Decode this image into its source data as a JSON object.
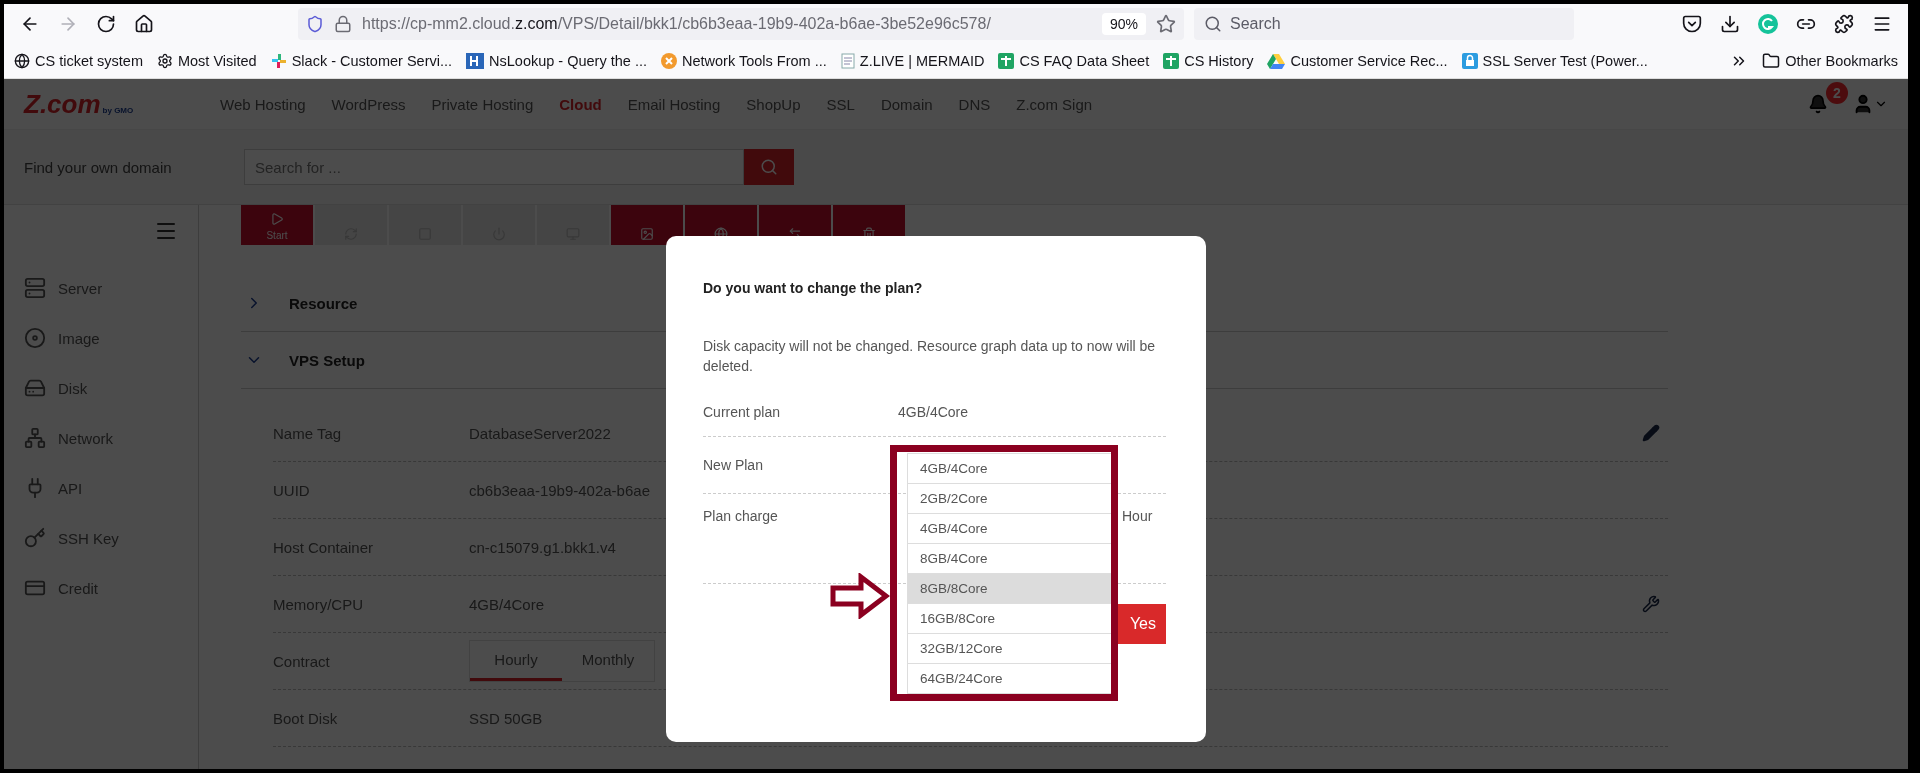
{
  "browser": {
    "back_disabled": false,
    "forward_disabled": true,
    "url": {
      "before": "https://cp-mm2.cloud.",
      "domain": "z.com",
      "after": "/VPS/Detail/bkk1/cb6b3eaa-19b9-402a-b6ae-3be52e96c578/"
    },
    "zoom": "90%",
    "search_placeholder": "Search",
    "bookmarks": [
      "CS ticket system",
      "Most Visited",
      "Slack - Customer Servi...",
      "NsLookup - Query the ...",
      "Network Tools From ...",
      "Z.LIVE | MERMAID",
      "CS FAQ Data Sheet",
      "CS History",
      "Customer Service Rec...",
      "SSL Server Test (Power..."
    ],
    "other_bookmarks": "Other Bookmarks"
  },
  "header": {
    "logo": "Z.com",
    "logo_sub": "by GMO",
    "nav": [
      {
        "label": "Web Hosting",
        "selected": false
      },
      {
        "label": "WordPress",
        "selected": false
      },
      {
        "label": "Private Hosting",
        "selected": false
      },
      {
        "label": "Cloud",
        "selected": true
      },
      {
        "label": "Email Hosting",
        "selected": false
      },
      {
        "label": "ShopUp",
        "selected": false
      },
      {
        "label": "SSL",
        "selected": false
      },
      {
        "label": "Domain",
        "selected": false
      },
      {
        "label": "DNS",
        "selected": false
      },
      {
        "label": "Z.com Sign",
        "selected": false
      }
    ],
    "notifications": "2"
  },
  "domain_search": {
    "label": "Find your own domain",
    "placeholder": "Search for ..."
  },
  "sidebar": {
    "items": [
      "Server",
      "Image",
      "Disk",
      "Network",
      "API",
      "SSH Key",
      "Credit"
    ]
  },
  "toolbar": [
    {
      "label": "Start",
      "disabled": false
    },
    {
      "disabled": true
    },
    {
      "disabled": true
    },
    {
      "disabled": true
    },
    {
      "disabled": true
    },
    {
      "disabled": false
    },
    {
      "disabled": false
    },
    {
      "disabled": false
    },
    {
      "disabled": false
    }
  ],
  "sections": [
    {
      "title": "Resource",
      "expanded": false
    },
    {
      "title": "VPS Setup",
      "expanded": true
    }
  ],
  "details": [
    {
      "label": "Name Tag",
      "value": "DatabaseServer2022",
      "editable": true
    },
    {
      "label": "UUID",
      "value": "cb6b3eaa-19b9-402a-b6ae"
    },
    {
      "label": "Host Container",
      "value": "cn-c15079.g1.bkk1.v4"
    },
    {
      "label": "Memory/CPU",
      "value": "4GB/4Core",
      "configurable": true
    },
    {
      "label": "Contract",
      "tabs": [
        {
          "label": "Hourly",
          "selected": true
        },
        {
          "label": "Monthly",
          "selected": false
        }
      ]
    },
    {
      "label": "Boot Disk",
      "value": "SSD 50GB"
    }
  ],
  "modal": {
    "title": "Do you want to change the plan?",
    "message": "Disk capacity will not be changed. Resource graph data up to now will be deleted.",
    "current_plan": {
      "label": "Current plan",
      "value": "4GB/4Core"
    },
    "new_plan": {
      "label": "New Plan"
    },
    "plan_charge": {
      "label": "Plan charge",
      "value": "Hour"
    },
    "confirm": "Yes",
    "options": [
      {
        "label": "4GB/4Core",
        "selected": false
      },
      {
        "label": "2GB/2Core",
        "selected": false
      },
      {
        "label": "4GB/4Core",
        "selected": false
      },
      {
        "label": "8GB/4Core",
        "selected": false
      },
      {
        "label": "8GB/8Core",
        "selected": true
      },
      {
        "label": "16GB/8Core",
        "selected": false
      },
      {
        "label": "32GB/12Core",
        "selected": false
      },
      {
        "label": "64GB/24Core",
        "selected": false
      }
    ]
  }
}
